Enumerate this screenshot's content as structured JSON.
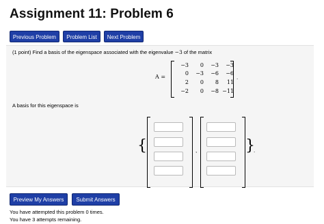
{
  "header": {
    "title": "Assignment 11: Problem 6"
  },
  "nav": {
    "previous_label": "Previous Problem",
    "list_label": "Problem List",
    "next_label": "Next Problem"
  },
  "problem": {
    "points": "(1 point)",
    "statement": "Find a basis of the eigenspace associated with the eigenvalue",
    "eigenvalue": "−3",
    "statement_tail": "of the matrix",
    "matrix_label": "A =",
    "matrix": [
      [
        "−3",
        "0",
        "−3",
        "−3"
      ],
      [
        "0",
        "−3",
        "−6",
        "−6"
      ],
      [
        "2",
        "0",
        "8",
        "11"
      ],
      [
        "−2",
        "0",
        "−8",
        "−11"
      ]
    ],
    "basis_label": "A basis for this eigenspace is",
    "vectors": [
      [
        "",
        "",
        "",
        ""
      ],
      [
        "",
        "",
        "",
        ""
      ]
    ]
  },
  "actions": {
    "preview_label": "Preview My Answers",
    "submit_label": "Submit Answers"
  },
  "status": {
    "attempted": "You have attempted this problem 0 times.",
    "remaining": "You have 3 attempts remaining."
  },
  "colors": {
    "button_bg": "#1f3fa6",
    "panel_bg": "#f5f5f5"
  }
}
